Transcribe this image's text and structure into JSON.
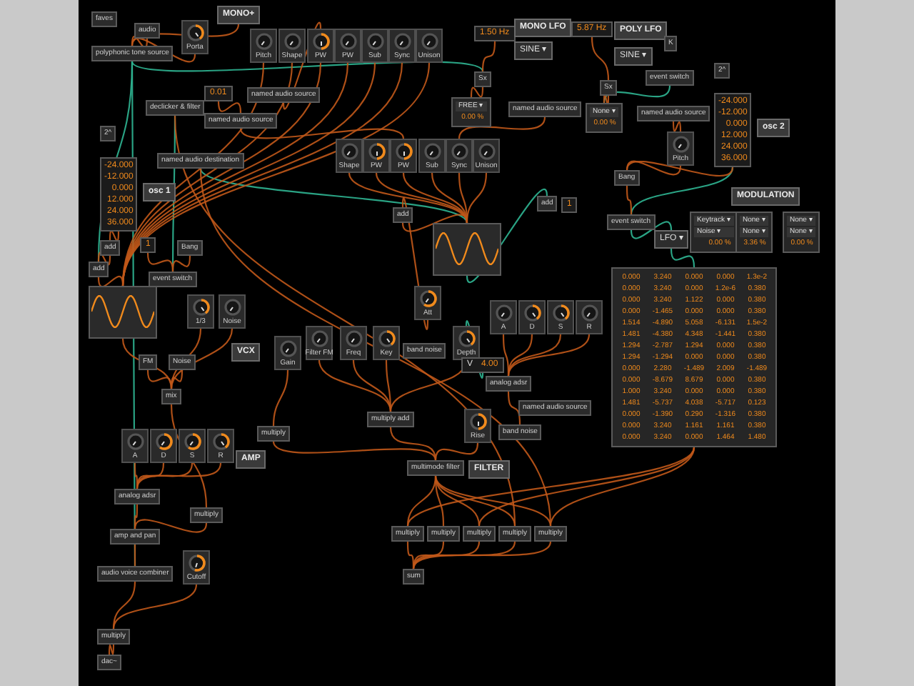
{
  "patch": {
    "modules": [
      {
        "kind": "object",
        "text": "faves"
      },
      {
        "kind": "object",
        "text": "audio"
      },
      {
        "kind": "knob",
        "label": "Porta",
        "level": 0.4
      },
      {
        "kind": "button",
        "text": "MONO+"
      },
      {
        "kind": "object",
        "text": "polyphonic tone source"
      },
      {
        "kind": "knob",
        "label": "Pitch"
      },
      {
        "kind": "knob",
        "label": "Shape"
      },
      {
        "kind": "knob",
        "label": "PW",
        "level": 0.5
      },
      {
        "kind": "knob",
        "label": "PW"
      },
      {
        "kind": "knob",
        "label": "Sub"
      },
      {
        "kind": "knob",
        "label": "Sync"
      },
      {
        "kind": "knob",
        "label": "Unison"
      },
      {
        "kind": "number",
        "value": "0.01"
      },
      {
        "kind": "object",
        "text": "named audio source"
      },
      {
        "kind": "object",
        "text": "declicker & filter"
      },
      {
        "kind": "object",
        "text": "named audio source"
      },
      {
        "kind": "object",
        "text": "2^"
      },
      {
        "kind": "object",
        "text": "named audio destination"
      },
      {
        "kind": "list",
        "values": [
          "-24.000",
          "-12.000",
          "0.000",
          "12.000",
          "24.000",
          "36.000"
        ]
      },
      {
        "kind": "button",
        "text": "osc 1"
      },
      {
        "kind": "object",
        "text": "add"
      },
      {
        "kind": "object",
        "text": "add"
      },
      {
        "kind": "number",
        "value": "1"
      },
      {
        "kind": "object",
        "text": "Bang"
      },
      {
        "kind": "object",
        "text": "event switch"
      },
      {
        "kind": "scope"
      },
      {
        "kind": "knob",
        "label": "1/3",
        "level": 0.4
      },
      {
        "kind": "knob",
        "label": "Noise"
      },
      {
        "kind": "object",
        "text": "FM"
      },
      {
        "kind": "object",
        "text": "Noise"
      },
      {
        "kind": "button",
        "text": "VCX"
      },
      {
        "kind": "knob",
        "label": "Gain"
      },
      {
        "kind": "knob",
        "label": "Filter FM"
      },
      {
        "kind": "knob",
        "label": "Freq"
      },
      {
        "kind": "knob",
        "label": "Key",
        "level": 0.4
      },
      {
        "kind": "object",
        "text": "band noise"
      },
      {
        "kind": "knob",
        "label": "Depth",
        "level": 0.4
      },
      {
        "kind": "object",
        "text": "mix"
      },
      {
        "kind": "object",
        "text": "multiply"
      },
      {
        "kind": "object",
        "text": "multiply add"
      },
      {
        "kind": "knob",
        "label": "A"
      },
      {
        "kind": "knob",
        "label": "D",
        "level": 0.6
      },
      {
        "kind": "knob",
        "label": "S",
        "level": 0.6
      },
      {
        "kind": "knob",
        "label": "R",
        "level": 0.4
      },
      {
        "kind": "button",
        "text": "AMP"
      },
      {
        "kind": "object",
        "text": "analog adsr"
      },
      {
        "kind": "object",
        "text": "multiply"
      },
      {
        "kind": "object",
        "text": "amp and pan"
      },
      {
        "kind": "object",
        "text": "audio voice combiner"
      },
      {
        "kind": "knob",
        "label": "Cutoff",
        "level": 0.55
      },
      {
        "kind": "object",
        "text": "multiply"
      },
      {
        "kind": "object",
        "text": "dac~"
      },
      {
        "kind": "number",
        "value": "1.50 Hz"
      },
      {
        "kind": "button",
        "text": "MONO LFO"
      },
      {
        "kind": "menu",
        "text": "SINE ▾"
      },
      {
        "kind": "object",
        "text": "Sx"
      },
      {
        "kind": "selector",
        "menus": [
          "FREE ▾"
        ],
        "value": "0.00 %"
      },
      {
        "kind": "object",
        "text": "named audio source"
      },
      {
        "kind": "knob",
        "label": "Shape"
      },
      {
        "kind": "knob",
        "label": "PW",
        "level": 0.5
      },
      {
        "kind": "knob",
        "label": "PW",
        "level": 0.5
      },
      {
        "kind": "knob",
        "label": "Sub"
      },
      {
        "kind": "knob",
        "label": "Sync"
      },
      {
        "kind": "knob",
        "label": "Unison"
      },
      {
        "kind": "object",
        "text": "add"
      },
      {
        "kind": "object",
        "text": "add"
      },
      {
        "kind": "number",
        "value": "1"
      },
      {
        "kind": "scope"
      },
      {
        "kind": "knob",
        "label": "Att",
        "level": 0.6
      },
      {
        "kind": "knob",
        "label": "A"
      },
      {
        "kind": "knob",
        "label": "D",
        "level": 0.4
      },
      {
        "kind": "knob",
        "label": "S",
        "level": 0.4
      },
      {
        "kind": "knob",
        "label": "R"
      },
      {
        "kind": "number",
        "label": "V",
        "value": "4.00"
      },
      {
        "kind": "object",
        "text": "analog adsr"
      },
      {
        "kind": "object",
        "text": "named audio source"
      },
      {
        "kind": "knob",
        "label": "Rise",
        "level": 0.5
      },
      {
        "kind": "object",
        "text": "band noise"
      },
      {
        "kind": "object",
        "text": "multimode filter"
      },
      {
        "kind": "button",
        "text": "FILTER"
      },
      {
        "kind": "object",
        "text": "multiply"
      },
      {
        "kind": "object",
        "text": "multiply"
      },
      {
        "kind": "object",
        "text": "multiply"
      },
      {
        "kind": "object",
        "text": "multiply"
      },
      {
        "kind": "object",
        "text": "multiply"
      },
      {
        "kind": "object",
        "text": "sum"
      },
      {
        "kind": "number",
        "value": "5.87 Hz"
      },
      {
        "kind": "button",
        "text": "POLY LFO"
      },
      {
        "kind": "object",
        "text": "K"
      },
      {
        "kind": "menu",
        "text": "SINE ▾"
      },
      {
        "kind": "object",
        "text": "event switch"
      },
      {
        "kind": "object",
        "text": "Sx"
      },
      {
        "kind": "selector",
        "menus": [
          "None ▾"
        ],
        "value": "0.00 %"
      },
      {
        "kind": "object",
        "text": "named audio source"
      },
      {
        "kind": "object",
        "text": "2^"
      },
      {
        "kind": "list",
        "values": [
          "-24.000",
          "-12.000",
          "0.000",
          "12.000",
          "24.000",
          "36.000"
        ]
      },
      {
        "kind": "button",
        "text": "osc 2"
      },
      {
        "kind": "knob",
        "label": "Pitch"
      },
      {
        "kind": "object",
        "text": "Bang"
      },
      {
        "kind": "object",
        "text": "event switch"
      },
      {
        "kind": "button",
        "text": "MODULATION"
      },
      {
        "kind": "selector",
        "menus": [
          "Keytrack ▾",
          "Noise ▾"
        ],
        "value": "0.00 %"
      },
      {
        "kind": "selector",
        "menus": [
          "None ▾",
          "None ▾"
        ],
        "value": "3.36 %"
      },
      {
        "kind": "selector",
        "menus": [
          "None ▾",
          "None ▾"
        ],
        "value": "0.00 %"
      },
      {
        "kind": "menu",
        "text": "LFO ▾"
      },
      {
        "kind": "table",
        "rows": [
          [
            "0.000",
            "3.240",
            "0.000",
            "0.000",
            "1.3e-2"
          ],
          [
            "0.000",
            "3.240",
            "0.000",
            "1.2e-6",
            "0.380"
          ],
          [
            "0.000",
            "3.240",
            "1.122",
            "0.000",
            "0.380"
          ],
          [
            "0.000",
            "-1.465",
            "0.000",
            "0.000",
            "0.380"
          ],
          [
            "1.514",
            "-4.890",
            "5.058",
            "-6.131",
            "1.5e-2"
          ],
          [
            "1.481",
            "-4.380",
            "4.348",
            "-1.441",
            "0.380"
          ],
          [
            "1.294",
            "-2.787",
            "1.294",
            "0.000",
            "0.380"
          ],
          [
            "1.294",
            "-1.294",
            "0.000",
            "0.000",
            "0.380"
          ],
          [
            "0.000",
            "2.280",
            "-1.489",
            "2.009",
            "-1.489"
          ],
          [
            "0.000",
            "-8.679",
            "8.679",
            "0.000",
            "0.380"
          ],
          [
            "1.000",
            "3.240",
            "0.000",
            "0.000",
            "0.380"
          ],
          [
            "1.481",
            "-5.737",
            "4.038",
            "-5.717",
            "0.123"
          ],
          [
            "0.000",
            "-1.390",
            "0.290",
            "-1.316",
            "0.380"
          ],
          [
            "0.000",
            "3.240",
            "1.161",
            "1.161",
            "0.380"
          ],
          [
            "0.000",
            "3.240",
            "0.000",
            "1.464",
            "1.480"
          ]
        ]
      }
    ]
  }
}
